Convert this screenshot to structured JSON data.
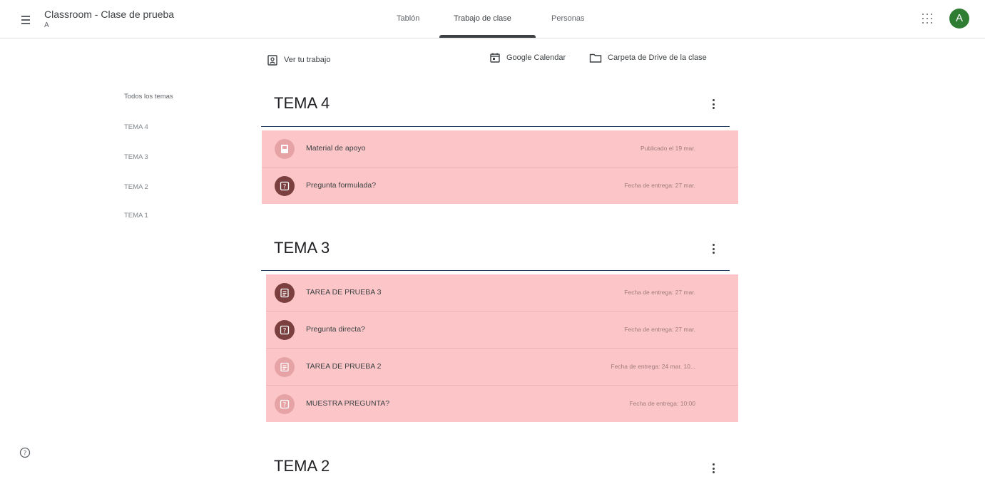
{
  "header": {
    "class_title": "Classroom - Clase de prueba",
    "class_subtitle": "A",
    "tabs": [
      {
        "label": "Tablón"
      },
      {
        "label": "Trabajo de clase"
      },
      {
        "label": "Personas"
      }
    ],
    "avatar_letter": "A",
    "avatar_color": "#2e7d32"
  },
  "toolbar": {
    "view_work_label": "Ver tu trabajo",
    "calendar_label": "Google Calendar",
    "drive_label": "Carpeta de Drive de la clase"
  },
  "topics_nav": {
    "items": [
      {
        "label": "Todos los temas"
      },
      {
        "label": "TEMA 4"
      },
      {
        "label": "TEMA 3"
      },
      {
        "label": "TEMA 2"
      },
      {
        "label": "TEMA 1"
      }
    ]
  },
  "topics": [
    {
      "title": "TEMA 4",
      "items": [
        {
          "title": "Material de apoyo",
          "meta": "Publicado el 19 mar.",
          "icon": "material-icon",
          "style": "faded"
        },
        {
          "title": "Pregunta formulada?",
          "meta": "Fecha de entrega: 27 mar.",
          "icon": "question-icon",
          "style": "active"
        }
      ]
    },
    {
      "title": "TEMA 3",
      "items": [
        {
          "title": "TAREA DE PRUEBA 3",
          "meta": "Fecha de entrega: 27 mar.",
          "icon": "assignment-icon",
          "style": "active"
        },
        {
          "title": "Pregunta directa?",
          "meta": "Fecha de entrega: 27 mar.",
          "icon": "question-icon",
          "style": "active"
        },
        {
          "title": "TAREA DE PRUEBA 2",
          "meta": "Fecha de entrega: 24 mar. 10...",
          "icon": "assignment-icon",
          "style": "faded"
        },
        {
          "title": "MUESTRA PREGUNTA?",
          "meta": "Fecha de entrega: 10:00",
          "icon": "question-icon",
          "style": "faded"
        }
      ]
    },
    {
      "title": "TEMA 2",
      "items": []
    }
  ],
  "colors": {
    "item_highlight": "#fcc6c8",
    "icon_dark": "#7b3f3f",
    "icon_light": "#e6a3a6",
    "topic_rule": "#1f3d5a"
  }
}
